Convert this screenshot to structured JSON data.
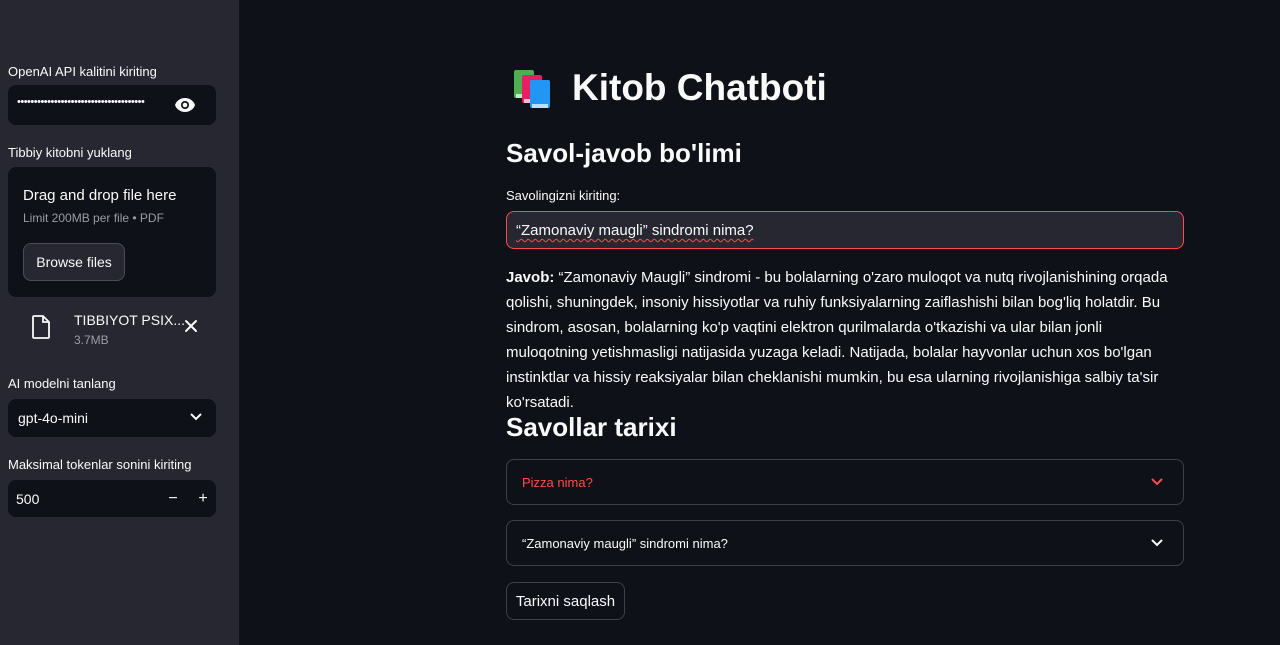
{
  "sidebar": {
    "api_key_label": "OpenAI API kalitini kiriting",
    "api_key_value": "••••••••••••••••••••••••••••••••••••••",
    "upload_label": "Tibbiy kitobni yuklang",
    "dropzone_title": "Drag and drop file here",
    "dropzone_limit": "Limit 200MB per file • PDF",
    "browse_label": "Browse files",
    "file_name": "TIBBIYOT PSIX...",
    "file_size": "3.7MB",
    "model_label": "AI modelni tanlang",
    "model_value": "gpt-4o-mini",
    "tokens_label": "Maksimal tokenlar sonini kiriting",
    "tokens_value": "500",
    "minus": "−",
    "plus": "+"
  },
  "main": {
    "title": "Kitob Chatboti",
    "qa_section": "Savol-javob bo'limi",
    "question_label": "Savolingizni kiriting:",
    "question_value": "“Zamonaviy maugli” sindromi nima?",
    "answer_prefix": "Javob:",
    "answer_text": " “Zamonaviy Maugli” sindromi - bu bolalarning o'zaro muloqot va nutq rivojlanishining orqada qolishi, shuningdek, insoniy hissiyotlar va ruhiy funksiyalarning zaiflashishi bilan bog'liq holatdir. Bu sindrom, asosan, bolalarning ko'p vaqtini elektron qurilmalarda o'tkazishi va ular bilan jonli muloqotning yetishmasligi natijasida yuzaga keladi. Natijada, bolalar hayvonlar uchun xos bo'lgan instinktlar va hissiy reaksiyalar bilan cheklanishi mumkin, bu esa ularning rivojlanishiga salbiy ta'sir ko'rsatadi.",
    "history_section": "Savollar tarixi",
    "history": [
      {
        "question": "Pizza nima?",
        "color": "#ff4b4b"
      },
      {
        "question": "“Zamonaviy maugli” sindromi nima?",
        "color": "#fafafa"
      }
    ],
    "save_label": "Tarixni saqlash"
  },
  "colors": {
    "background": "#0e1117",
    "sidebar": "#262730",
    "accent": "#ff4b4b"
  },
  "icons": {
    "app": "books-icon",
    "password_toggle": "eye-icon",
    "file": "file-icon",
    "remove": "close-icon",
    "dropdown": "chevron-down-icon"
  }
}
